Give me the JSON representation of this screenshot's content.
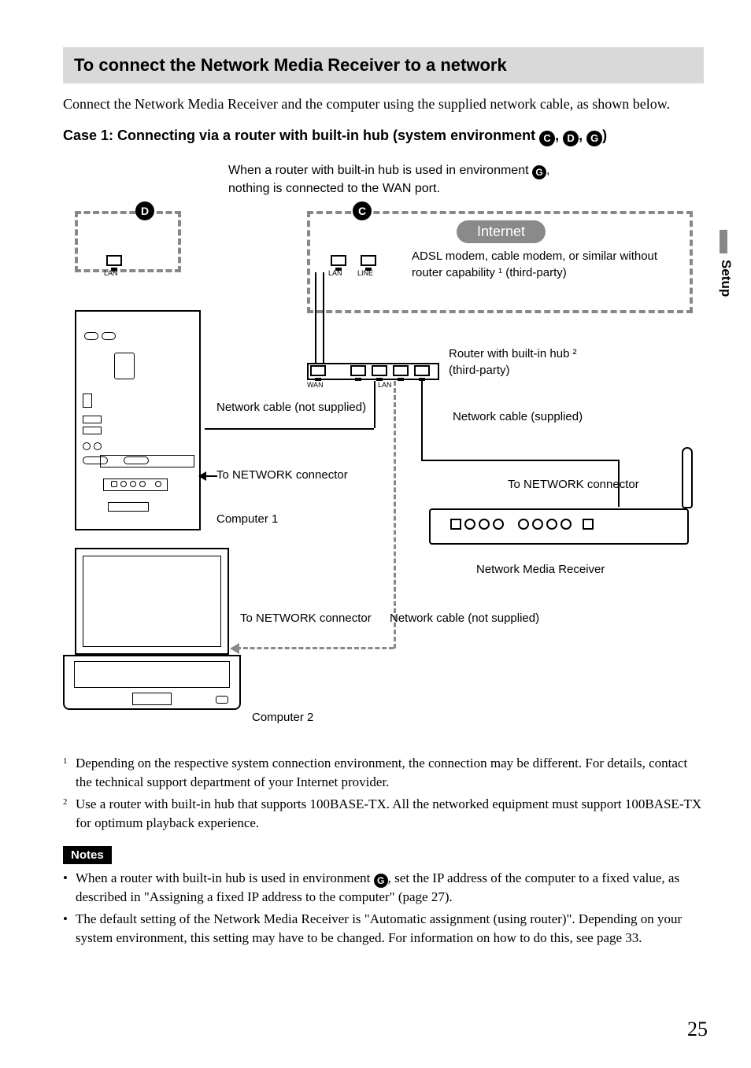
{
  "heading": "To connect the Network Media Receiver to a network",
  "intro": "Connect the Network Media Receiver and the computer using the supplied network cable, as shown below.",
  "case_heading_prefix": "Case 1: Connecting via a router with built-in hub (system environment ",
  "case_heading_letters": [
    "C",
    "D",
    "G"
  ],
  "case_heading_suffix": ")",
  "diagram": {
    "env_note_line1": "When a router with built-in hub is used in environment ",
    "env_note_letter": "G",
    "env_note_line1_suffix": ",",
    "env_note_line2": "nothing is connected to the WAN port.",
    "badge_d": "D",
    "badge_c": "C",
    "internet": "Internet",
    "modem_label": "ADSL modem, cable modem, or similar without router capability ¹ (third-party)",
    "router_label_l1": "Router with built-in hub ²",
    "router_label_l2": "(third-party)",
    "network_cable_not_supplied": "Network cable (not supplied)",
    "network_cable_supplied": "Network cable (supplied)",
    "to_network_connector": "To NETWORK connector",
    "computer1": "Computer 1",
    "nmr": "Network Media Receiver",
    "computer2": "Computer 2",
    "port_lan": "LAN",
    "port_line": "LINE",
    "port_wan": "WAN"
  },
  "footnotes": {
    "fn1": "Depending on the respective system connection environment, the connection may be different. For details, contact the technical support department of your Internet provider.",
    "fn2": "Use a router with built-in hub that supports 100BASE-TX. All the networked equipment must support 100BASE-TX for optimum playback experience."
  },
  "notes_label": "Notes",
  "notes": {
    "n1_prefix": "When a router with built-in hub is used in environment ",
    "n1_letter": "G",
    "n1_suffix": ", set the IP address of the computer to a fixed value, as described in \"Assigning a fixed IP address to the computer\" (page 27).",
    "n2": "The default setting of the Network Media Receiver is \"Automatic assignment (using router)\". Depending on your system environment, this setting may have to be changed. For information on how to do this, see page 33."
  },
  "side_section": "Setup",
  "page_number": "25"
}
